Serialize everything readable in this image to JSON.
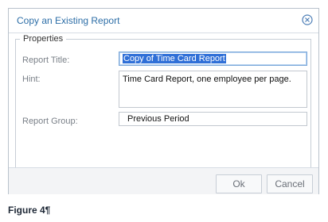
{
  "dialog": {
    "title": "Copy an Existing Report",
    "close_icon": "close-circle-icon"
  },
  "properties": {
    "legend": "Properties",
    "report_title_label": "Report Title:",
    "report_title_value": "Copy of Time Card Report",
    "hint_label": "Hint:",
    "hint_value": "Time Card Report, one employee per page.",
    "report_group_label": "Report Group:",
    "report_group_value": "Previous Period"
  },
  "footer": {
    "ok_label": "Ok",
    "cancel_label": "Cancel"
  },
  "caption": "Figure 4¶",
  "colors": {
    "title": "#2d6ea7",
    "selection": "#2f6fd7",
    "border": "#b9c2cc",
    "label": "#7a8088"
  }
}
